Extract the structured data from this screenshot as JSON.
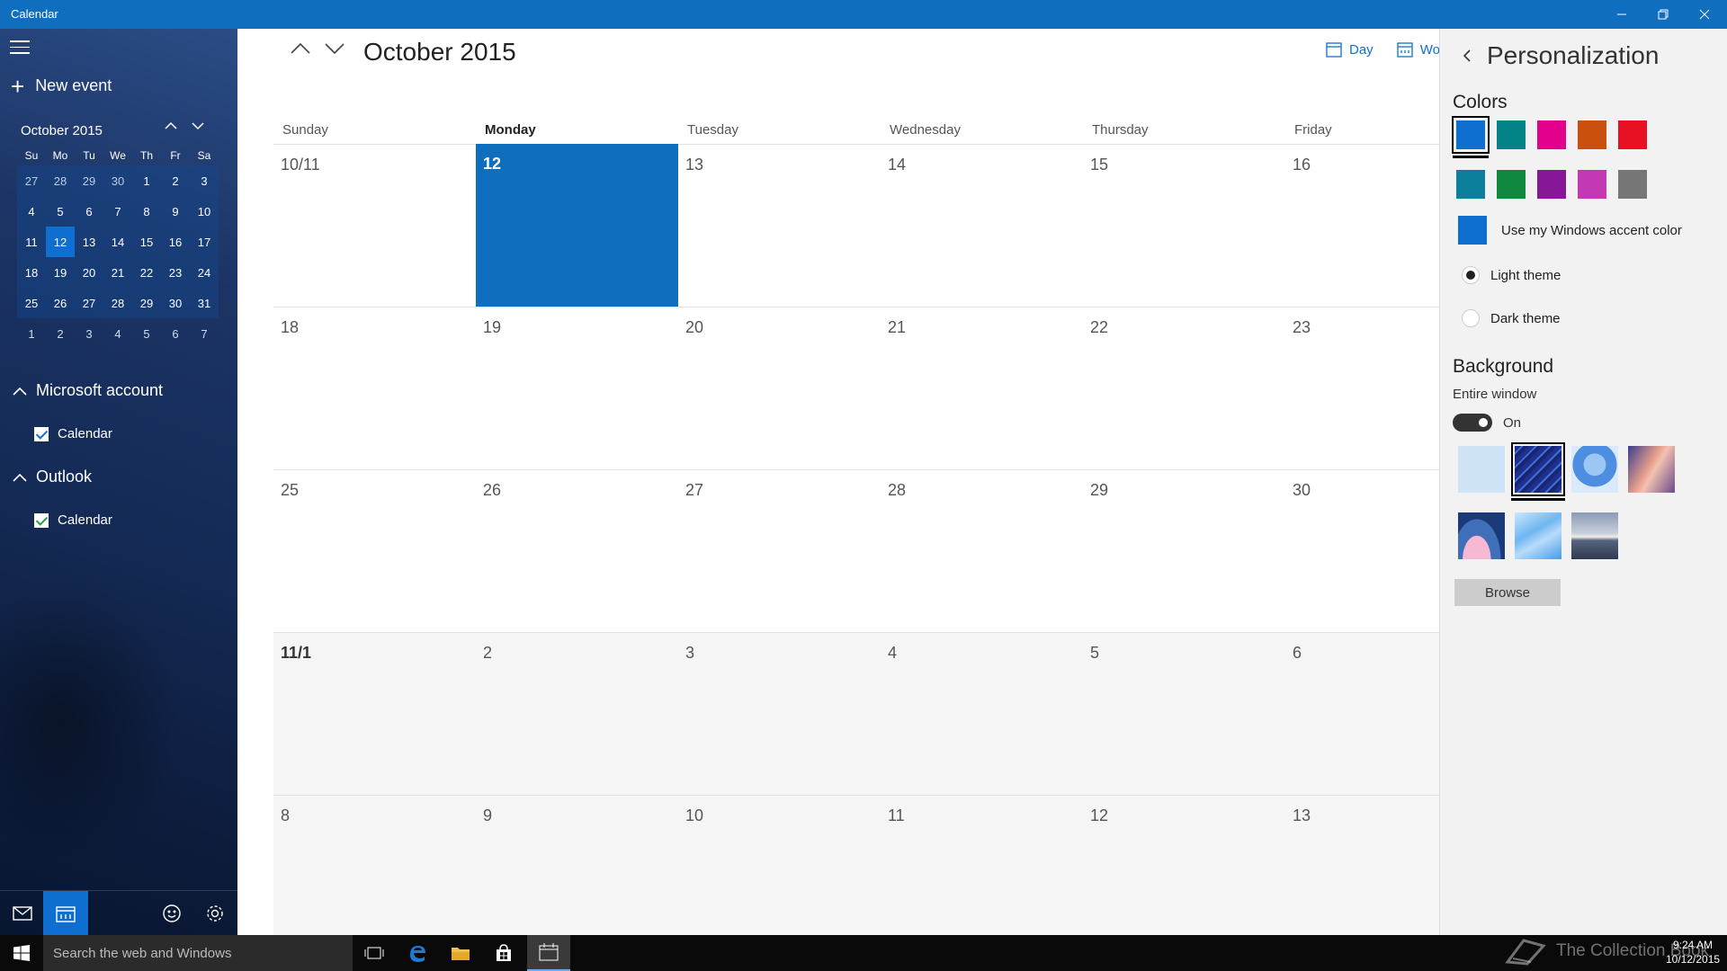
{
  "titlebar": {
    "title": "Calendar"
  },
  "sidebar": {
    "new_event": "New event",
    "mini_calendar": {
      "month": "October 2015",
      "weekdays": [
        "Su",
        "Mo",
        "Tu",
        "We",
        "Th",
        "Fr",
        "Sa"
      ],
      "weeks": [
        [
          "27",
          "28",
          "29",
          "30",
          "1",
          "2",
          "3"
        ],
        [
          "4",
          "5",
          "6",
          "7",
          "8",
          "9",
          "10"
        ],
        [
          "11",
          "12",
          "13",
          "14",
          "15",
          "16",
          "17"
        ],
        [
          "18",
          "19",
          "20",
          "21",
          "22",
          "23",
          "24"
        ],
        [
          "25",
          "26",
          "27",
          "28",
          "29",
          "30",
          "31"
        ],
        [
          "1",
          "2",
          "3",
          "4",
          "5",
          "6",
          "7"
        ]
      ]
    },
    "accounts": [
      {
        "name": "Microsoft account",
        "calendar": "Calendar"
      },
      {
        "name": "Outlook",
        "calendar": "Calendar"
      }
    ]
  },
  "main": {
    "month_title": "October 2015",
    "views": {
      "day": "Day",
      "work_week": "Wor"
    },
    "day_headers": [
      "Sunday",
      "Monday",
      "Tuesday",
      "Wednesday",
      "Thursday",
      "Friday"
    ],
    "weeks": [
      [
        "10/11",
        "12",
        "13",
        "14",
        "15",
        "16"
      ],
      [
        "18",
        "19",
        "20",
        "21",
        "22",
        "23"
      ],
      [
        "25",
        "26",
        "27",
        "28",
        "29",
        "30"
      ],
      [
        "11/1",
        "2",
        "3",
        "4",
        "5",
        "6"
      ],
      [
        "8",
        "9",
        "10",
        "11",
        "12",
        "13"
      ]
    ]
  },
  "panel": {
    "title": "Personalization",
    "colors_heading": "Colors",
    "colors": [
      "#0f6fd0",
      "#038387",
      "#e3008c",
      "#ca5010",
      "#e81123",
      "#0b7f9c",
      "#10893e",
      "#881798",
      "#c239b3",
      "#767676"
    ],
    "accent_color": "#0f6fd0",
    "use_accent": "Use my Windows accent color",
    "light_theme": "Light theme",
    "dark_theme": "Dark theme",
    "background_heading": "Background",
    "entire_window": "Entire window",
    "toggle_state": "On",
    "browse": "Browse"
  },
  "taskbar": {
    "search_placeholder": "Search the web and Windows",
    "time": "9:24 AM",
    "date": "10/12/2015",
    "watermark": "The Collection Book"
  }
}
